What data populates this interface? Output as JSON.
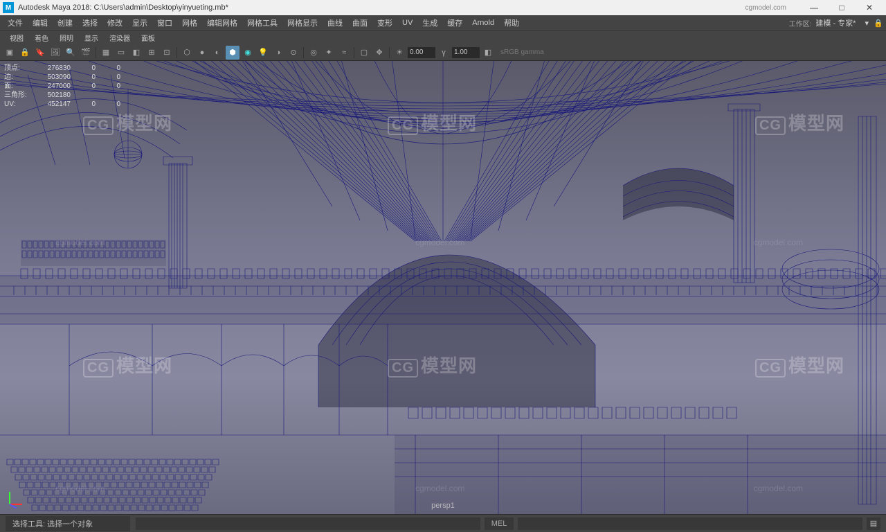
{
  "titlebar": {
    "app_icon": "M",
    "title": "Autodesk Maya 2018: C:\\Users\\admin\\Desktop\\yinyueting.mb*",
    "watermark_site": "cgmodel.com",
    "min": "—",
    "max": "□",
    "close": "✕"
  },
  "menu": {
    "items": [
      "文件",
      "编辑",
      "创建",
      "选择",
      "修改",
      "显示",
      "窗口",
      "网格",
      "编辑网格",
      "网格工具",
      "网格显示",
      "曲线",
      "曲面",
      "变形",
      "UV",
      "生成",
      "缓存",
      "Arnold",
      "帮助"
    ],
    "workspace_label": "工作区:",
    "workspace_value": "建模 - 专家*"
  },
  "panel": {
    "items": [
      "视图",
      "着色",
      "照明",
      "显示",
      "渲染器",
      "面板"
    ]
  },
  "iconbar": {
    "exposure": "0.00",
    "gamma": "1.00",
    "gamma_space": "sRGB gamma"
  },
  "hud": {
    "rows": [
      {
        "label": "顶点:",
        "v1": "276830",
        "v2": "0",
        "v3": "0"
      },
      {
        "label": "边:",
        "v1": "503090",
        "v2": "0",
        "v3": "0"
      },
      {
        "label": "面:",
        "v1": "247000",
        "v2": "0",
        "v3": "0"
      },
      {
        "label": "三角形:",
        "v1": "502180",
        "v2": "",
        "v3": ""
      },
      {
        "label": "UV:",
        "v1": "452147",
        "v2": "0",
        "v3": "0"
      }
    ]
  },
  "camera": "persp1",
  "watermark": {
    "logo": "CG",
    "text": "模型网",
    "site": "cgmodel.com"
  },
  "status": {
    "tool_hint": "选择工具: 选择一个对象",
    "script_lang": "MEL"
  }
}
